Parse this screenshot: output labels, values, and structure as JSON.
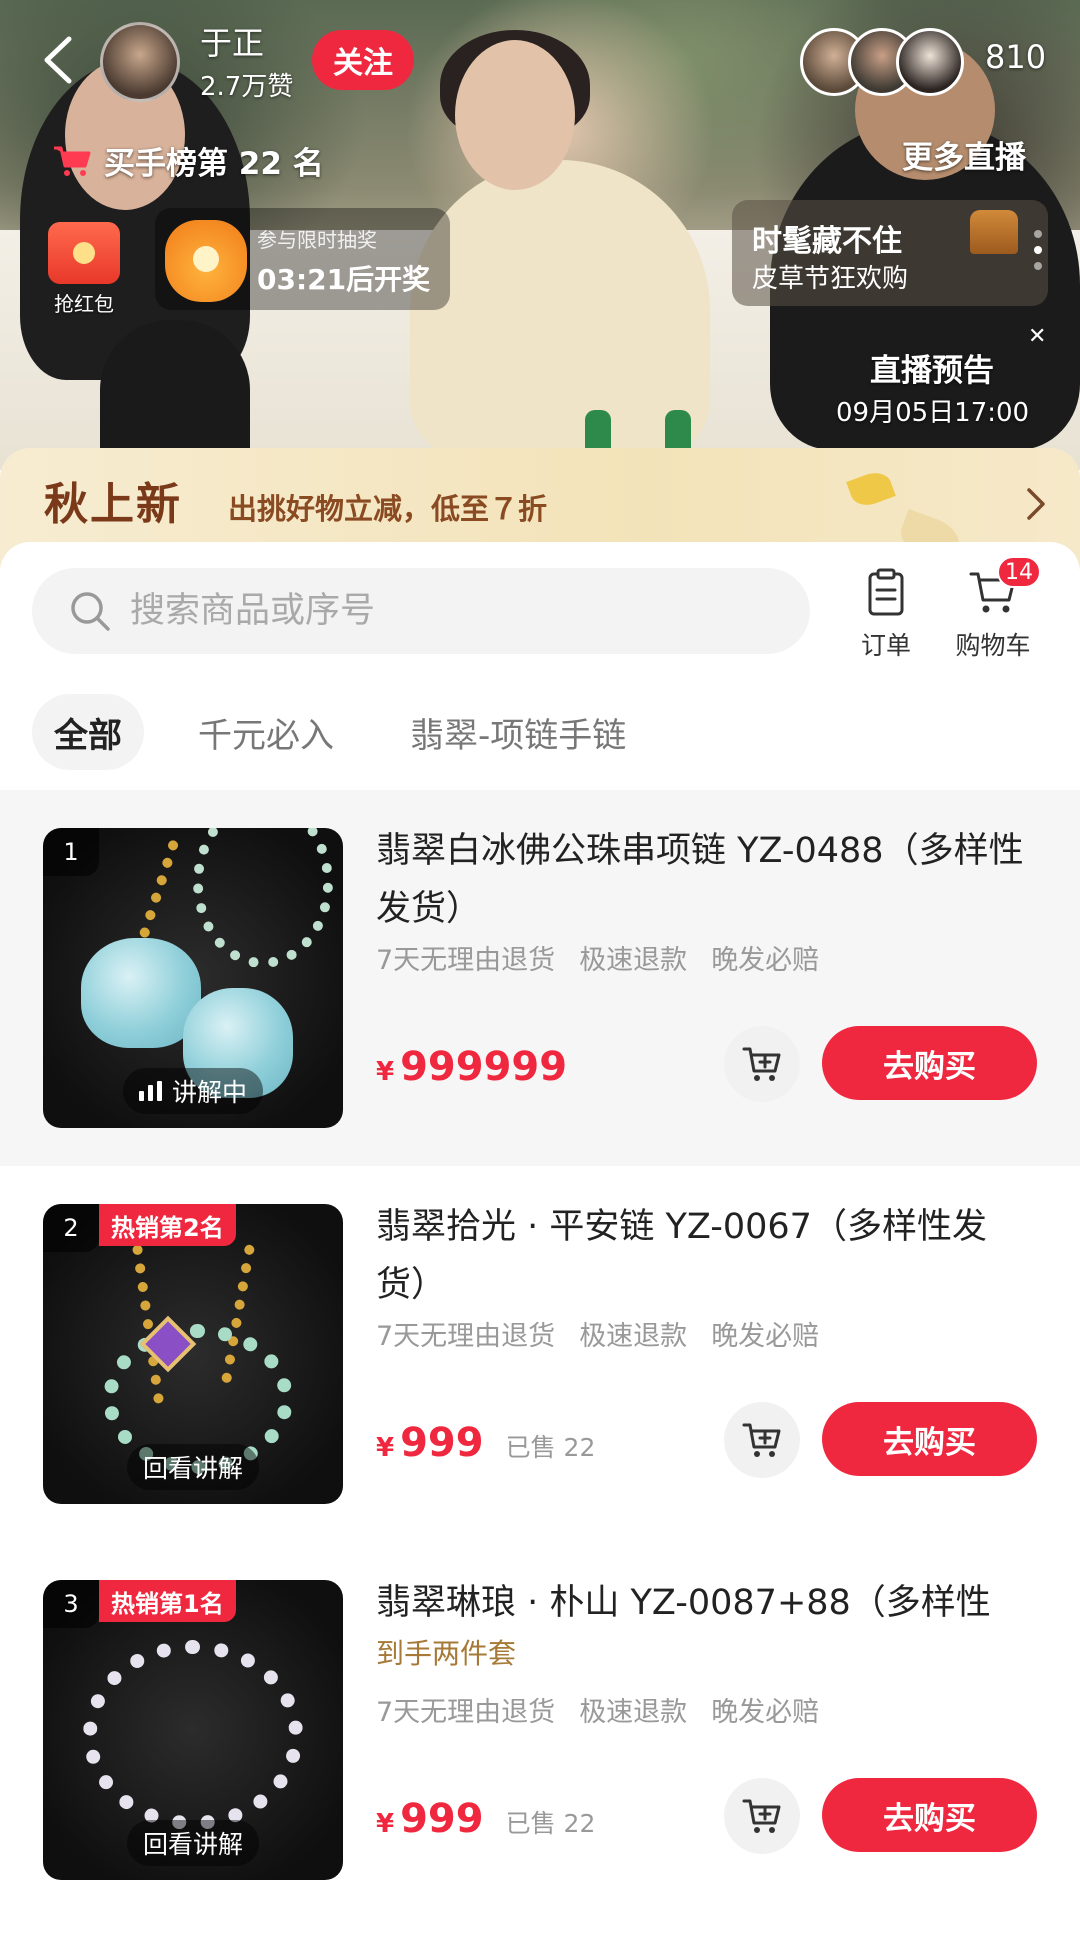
{
  "live": {
    "host_name": "于正",
    "host_likes": "2.7万赞",
    "follow_label": "关注",
    "viewer_count": "810",
    "rank_label": "买手榜第 22 名",
    "more_live_label": "更多直播",
    "redpacket_label": "抢红包",
    "lottery_title": "参与限时抽奖",
    "lottery_countdown": "03:21后开奖",
    "promo_title": "时髦藏不住",
    "promo_subtitle": "皮草节狂欢购",
    "preview_title": "直播预告",
    "preview_time": "09月05日17:00"
  },
  "banner": {
    "title": "秋上新",
    "subtitle": "出挑好物立减，低至７折"
  },
  "search": {
    "placeholder": "搜索商品或序号"
  },
  "toolbar": {
    "orders_label": "订单",
    "cart_label": "购物车",
    "cart_badge": "14"
  },
  "tabs": [
    {
      "label": "全部",
      "active": true
    },
    {
      "label": "千元必入",
      "active": false
    },
    {
      "label": "翡翠-项链手链",
      "active": false
    }
  ],
  "products": [
    {
      "index": "1",
      "title": "翡翠白冰佛公珠串项链 YZ-0488（多样性发货）",
      "subtitle": "",
      "tags": [
        "7天无理由退货",
        "极速退款",
        "晚发必赔"
      ],
      "price": "999999",
      "currency": "¥",
      "sold": "",
      "caption": "讲解中",
      "hot_badge": "",
      "buy_label": "去购买"
    },
    {
      "index": "2",
      "title": "翡翠拾光 · 平安链 YZ-0067（多样性发货）",
      "subtitle": "",
      "tags": [
        "7天无理由退货",
        "极速退款",
        "晚发必赔"
      ],
      "price": "999",
      "currency": "¥",
      "sold": "已售 22",
      "caption": "回看讲解",
      "hot_badge": "热销第2名",
      "buy_label": "去购买"
    },
    {
      "index": "3",
      "title": "翡翠琳琅 · 朴山 YZ-0087+88（多样性",
      "subtitle": "到手两件套",
      "tags": [
        "7天无理由退货",
        "极速退款",
        "晚发必赔"
      ],
      "price": "999",
      "currency": "¥",
      "sold": "已售 22",
      "caption": "回看讲解",
      "hot_badge": "热销第1名",
      "buy_label": "去购买"
    }
  ]
}
